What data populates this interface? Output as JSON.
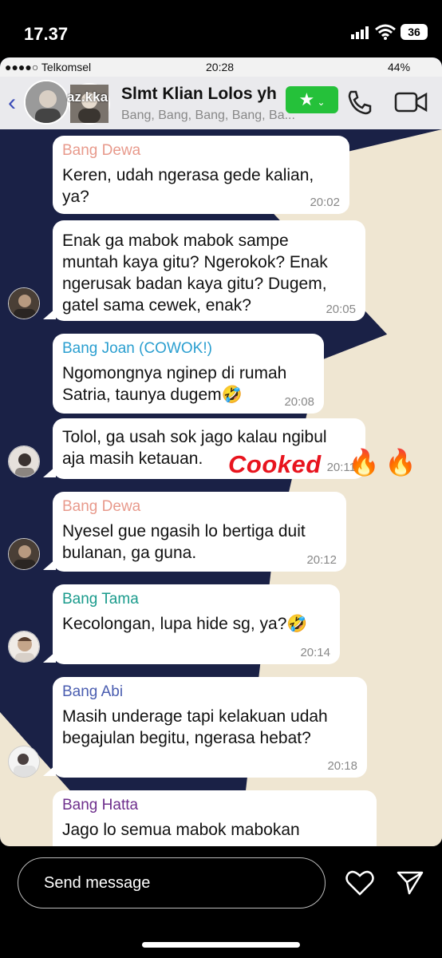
{
  "phone_status": {
    "time": "17.37",
    "battery": "36"
  },
  "screenshot_status": {
    "carrier": "●●●●○ Telkomsel",
    "time": "20:28",
    "battery": "44%"
  },
  "story_header": {
    "username": "az.kka"
  },
  "chat_header": {
    "title": "Slmt Klian Lolos yh",
    "subtitle": "Bang, Bang, Bang, Bang, Ba...",
    "back_icon": "chevron-left-icon",
    "star_icon": "star-icon",
    "call_icon": "phone-icon",
    "video_icon": "video-icon"
  },
  "messages": [
    {
      "sender": "Bang Dewa",
      "sender_color": "#e89a8c",
      "text": "Keren, udah ngerasa gede kalian,\nya?",
      "time": "20:02"
    },
    {
      "sender": "",
      "text": "Enak ga mabok mabok sampe\nmuntah kaya gitu? Ngerokok? Enak\nngerusak badan kaya gitu? Dugem,\ngatel sama cewek, enak?",
      "time": "20:05"
    },
    {
      "sender": "Bang Joan (COWOK!)",
      "sender_color": "#2b9fd0",
      "text": "Ngomongnya nginep di rumah\nSatria, taunya dugem🤣",
      "time": "20:08"
    },
    {
      "sender": "",
      "text": "Tolol, ga usah sok jago kalau ngibul\naja masih ketauan.",
      "time": "20:11"
    },
    {
      "sender": "Bang Dewa",
      "sender_color": "#e89a8c",
      "text": "Nyesel gue ngasih lo bertiga duit\nbulanan, ga guna.",
      "time": "20:12"
    },
    {
      "sender": "Bang Tama",
      "sender_color": "#1a9b8c",
      "text": "Kecolongan, lupa hide sg, ya?🤣",
      "time": "20:14"
    },
    {
      "sender": "Bang Abi",
      "sender_color": "#4a5db0",
      "text": "Masih underage tapi kelakuan udah\nbegajulan begitu, ngerasa hebat?",
      "time": "20:18"
    },
    {
      "sender": "Bang Hatta",
      "sender_color": "#6e2f8c",
      "text": "Jago lo semua mabok mabokan",
      "time": ""
    }
  ],
  "sticker": {
    "text": "Cooked",
    "emoji": "🔥",
    "color": "#e8141e"
  },
  "bottom_bar": {
    "placeholder": "Send message",
    "heart_icon": "heart-icon",
    "share_icon": "paper-plane-icon"
  }
}
